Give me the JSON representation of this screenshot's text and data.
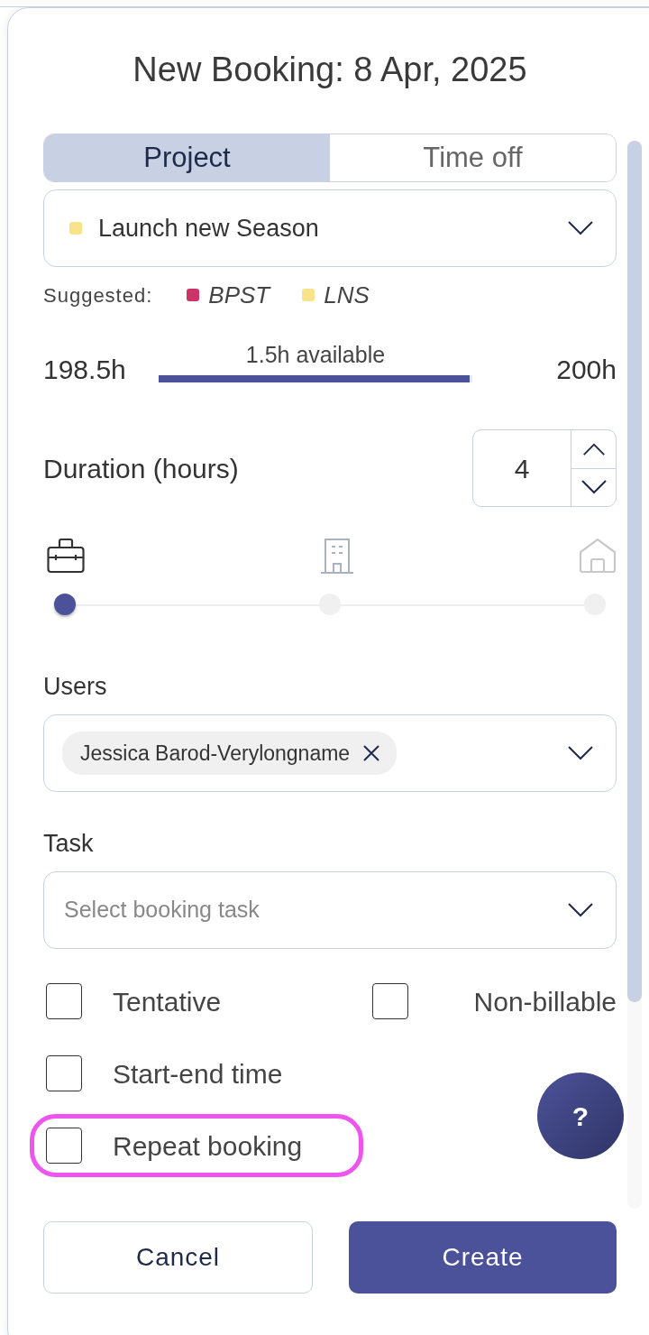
{
  "dialog": {
    "title": "New Booking: 8 Apr, 2025"
  },
  "tabs": [
    {
      "label": "Project",
      "selected": true
    },
    {
      "label": "Time off",
      "selected": false
    }
  ],
  "project": {
    "value": "Launch new Season",
    "color": "#f8e38a"
  },
  "suggested": {
    "label": "Suggested:",
    "items": [
      {
        "label": "BPST",
        "color": "#cc3366"
      },
      {
        "label": "LNS",
        "color": "#f8e38a"
      }
    ]
  },
  "availability": {
    "used": "198.5h",
    "caption": "1.5h available",
    "total": "200h",
    "level": 0.99
  },
  "duration": {
    "label": "Duration (hours)",
    "value": "4"
  },
  "locations": [
    {
      "kind": "office-bag",
      "selected": true
    },
    {
      "kind": "building",
      "selected": false
    },
    {
      "kind": "home",
      "selected": false
    }
  ],
  "users": {
    "label": "Users",
    "chips": [
      "Jessica Barod-Verylongname"
    ]
  },
  "task": {
    "label": "Task",
    "placeholder": "Select booking task"
  },
  "options": [
    {
      "label": "Tentative",
      "checked": false,
      "highlighted": false
    },
    {
      "label": "Non-billable",
      "checked": false,
      "highlighted": false
    },
    {
      "label": "Start-end time",
      "checked": false,
      "highlighted": false
    },
    {
      "label": "Repeat booking",
      "checked": false,
      "highlighted": true
    }
  ],
  "buttons": [
    {
      "label": "Cancel",
      "kind": "secondary"
    },
    {
      "label": "Create",
      "kind": "primary"
    }
  ],
  "help": {
    "label": "?"
  }
}
